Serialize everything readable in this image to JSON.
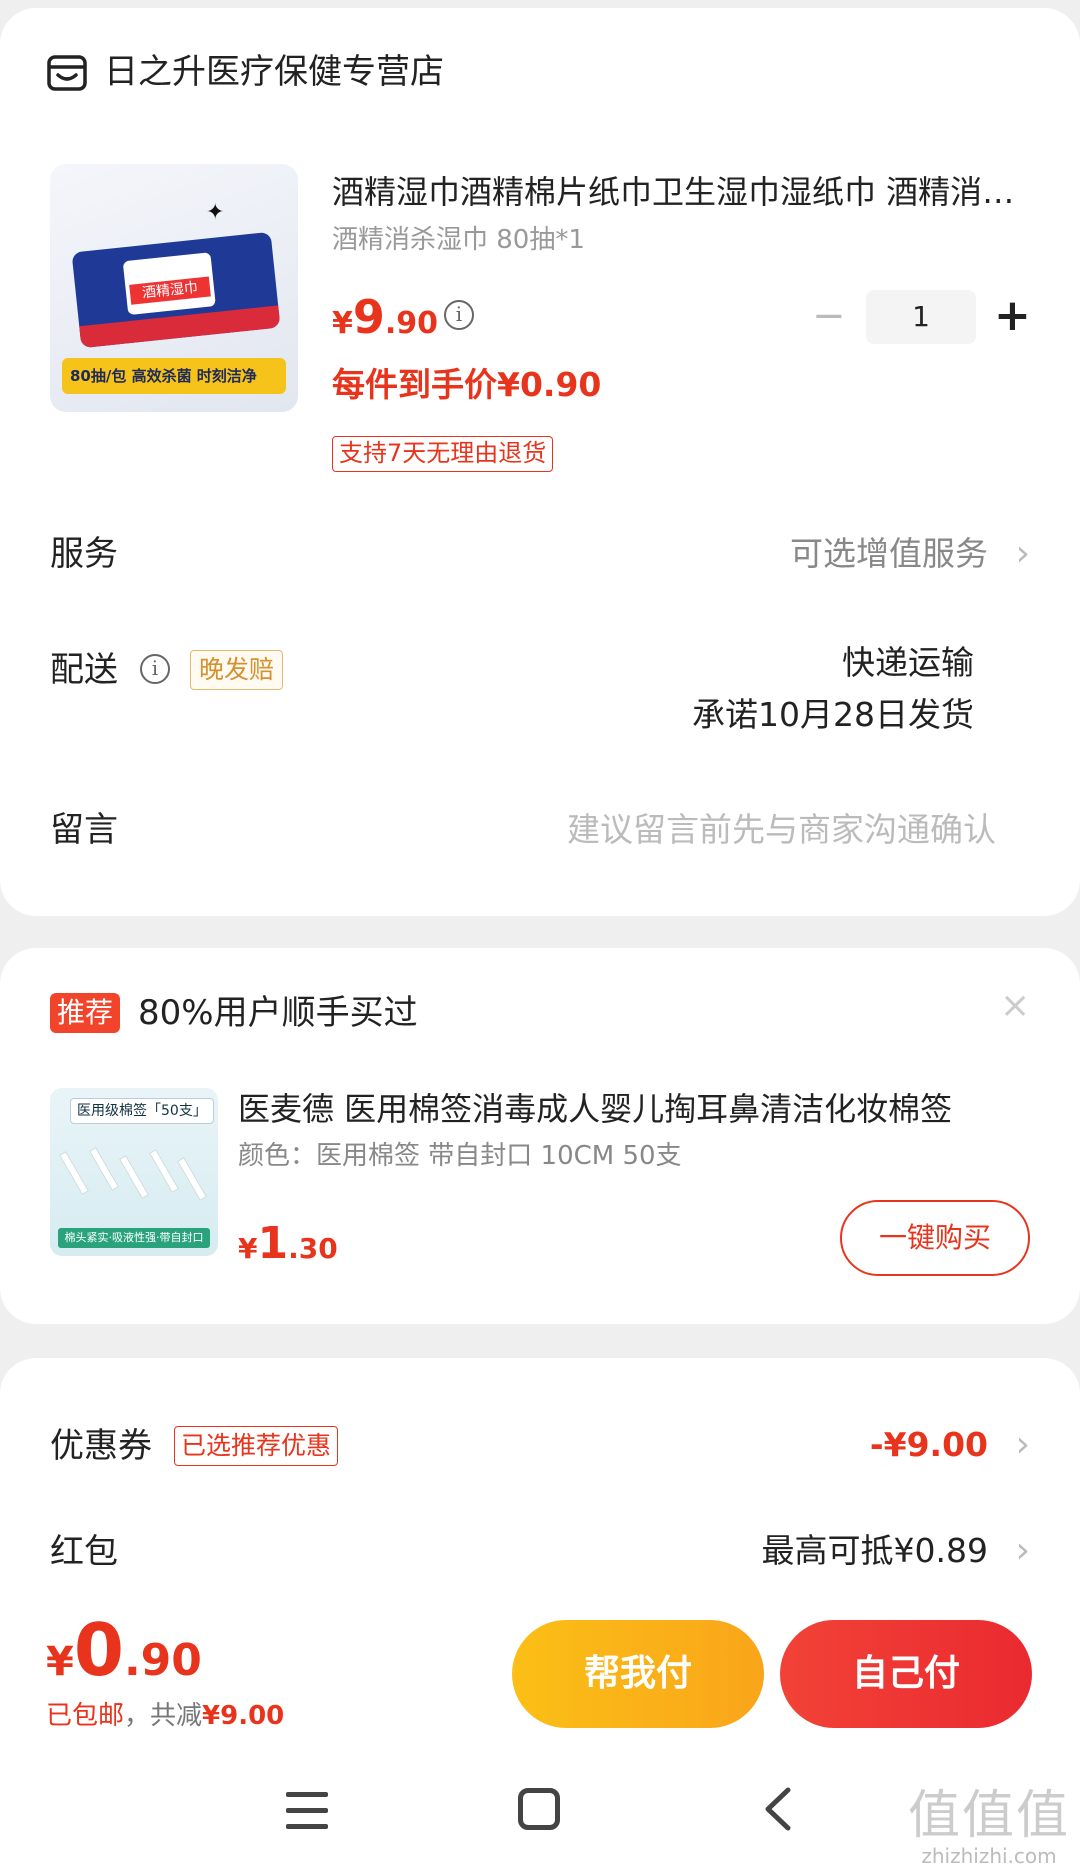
{
  "shop": {
    "icon": "shop-icon",
    "name": "日之升医疗保健专营店"
  },
  "product": {
    "title": "酒精湿巾酒精棉片纸巾卫生湿巾湿纸巾 酒精消毒湿巾",
    "spec": "酒精消杀湿巾 80抽*1",
    "price_currency": "¥",
    "price_int": "9",
    "price_dec": ".90",
    "per_price": "每件到手价¥0.90",
    "return_tag": "支持7天无理由退货",
    "image_banner": "80抽/包 高效杀菌 时刻洁净",
    "image_label": "酒精湿巾",
    "quantity": "1",
    "qty_minus": "−",
    "qty_plus": "+"
  },
  "service": {
    "label": "服务",
    "value": "可选增值服务"
  },
  "delivery": {
    "label": "配送",
    "late_tag": "晚发赔",
    "method": "快递运输",
    "promise": "承诺10月28日发货"
  },
  "message": {
    "label": "留言",
    "placeholder": "建议留言前先与商家沟通确认"
  },
  "recommend": {
    "badge": "推荐",
    "title": "80%用户顺手买过",
    "close": "×",
    "item": {
      "name": "医麦德 医用棉签消毒成人婴儿掏耳鼻清洁化妆棉签",
      "spec": "颜色：医用棉签 带自封口 10CM 50支",
      "price_currency": "¥",
      "price_int": "1",
      "price_dec": ".30",
      "image_tag": "医用级棉签「50支」",
      "image_band": "棉头紧实·吸液性强·带自封口",
      "buy_label": "一键购买"
    }
  },
  "discounts": {
    "coupon_label": "优惠券",
    "coupon_tag": "已选推荐优惠",
    "coupon_value": "-¥9.00",
    "redpacket_label": "红包",
    "redpacket_value": "最高可抵¥0.89"
  },
  "bottom": {
    "currency": "¥",
    "total_int": "0",
    "total_dec": ".90",
    "free_shipping": "已包邮",
    "reduced_prefix": "，共减",
    "reduced_amount": "¥9.00",
    "help_pay": "帮我付",
    "self_pay": "自己付"
  },
  "watermark": {
    "glyphs": "值值值",
    "site": "zhizhizhi.com"
  },
  "colors": {
    "accent_red": "#e8341c",
    "pay_red": "#ea2a30",
    "help_yellow": "#fbbf16",
    "late_tag_orange": "#d4912e"
  }
}
